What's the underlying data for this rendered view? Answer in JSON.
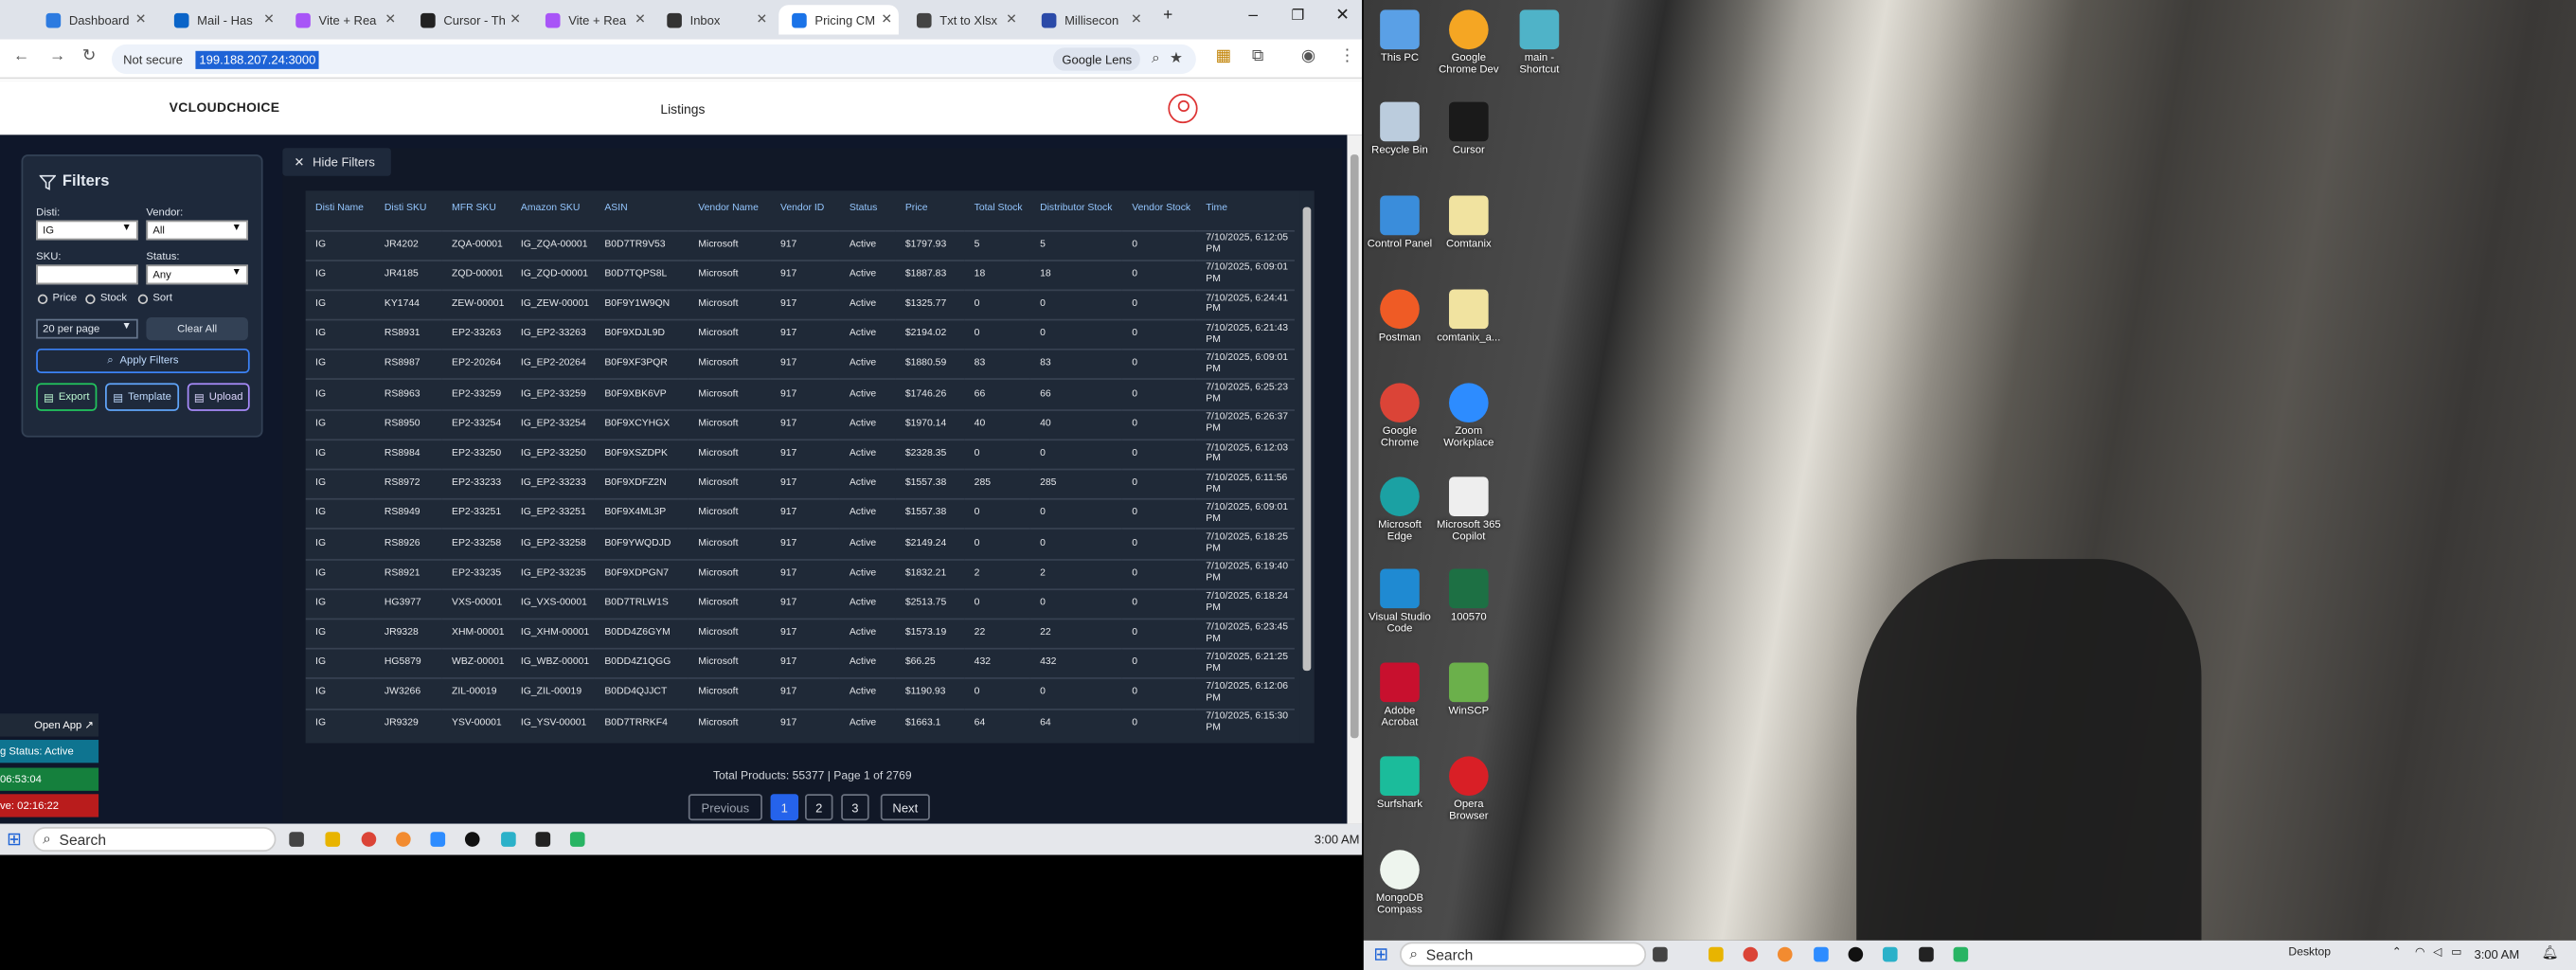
{
  "browser": {
    "tabs": [
      "Dashboard",
      "Mail - Has",
      "Vite + Rea",
      "Cursor - Th",
      "Vite + Rea",
      "Inbox",
      "Pricing CM",
      "Txt to Xlsx",
      "Millisecon"
    ],
    "address": {
      "security": "Not secure",
      "url": "199.188.207.24:3000"
    },
    "lens_label": "Google Lens"
  },
  "app": {
    "logo": "VCLOUDCHOICE",
    "nav_title": "Listings",
    "filters": {
      "title": "Filters",
      "disti_label": "Disti:",
      "disti_value": "IG",
      "vendor_label": "Vendor:",
      "vendor_value": "All",
      "sku_label": "SKU:",
      "sku_value": "",
      "status_label": "Status:",
      "status_value": "Any",
      "sort_options": [
        "Price",
        "Stock",
        "Sort"
      ],
      "per_page": "20 per page",
      "clear_all": "Clear All",
      "apply": "Apply Filters",
      "export": "Export",
      "template": "Template",
      "upload": "Upload"
    },
    "hide_filters": "Hide Filters",
    "table": {
      "headers": [
        "Disti Name",
        "Disti SKU",
        "MFR SKU",
        "Amazon SKU",
        "ASIN",
        "Vendor Name",
        "Vendor ID",
        "Status",
        "Price",
        "Total Stock",
        "Distributor Stock",
        "Vendor Stock",
        "Time"
      ],
      "rows": [
        [
          "IG",
          "JR4202",
          "ZQA-00001",
          "IG_ZQA-00001",
          "B0D7TR9V53",
          "Microsoft",
          "917",
          "Active",
          "$1797.93",
          "5",
          "5",
          "0",
          "7/10/2025, 6:12:05 PM"
        ],
        [
          "IG",
          "JR4185",
          "ZQD-00001",
          "IG_ZQD-00001",
          "B0D7TQPS8L",
          "Microsoft",
          "917",
          "Active",
          "$1887.83",
          "18",
          "18",
          "0",
          "7/10/2025, 6:09:01 PM"
        ],
        [
          "IG",
          "KY1744",
          "ZEW-00001",
          "IG_ZEW-00001",
          "B0F9Y1W9QN",
          "Microsoft",
          "917",
          "Active",
          "$1325.77",
          "0",
          "0",
          "0",
          "7/10/2025, 6:24:41 PM"
        ],
        [
          "IG",
          "RS8931",
          "EP2-33263",
          "IG_EP2-33263",
          "B0F9XDJL9D",
          "Microsoft",
          "917",
          "Active",
          "$2194.02",
          "0",
          "0",
          "0",
          "7/10/2025, 6:21:43 PM"
        ],
        [
          "IG",
          "RS8987",
          "EP2-20264",
          "IG_EP2-20264",
          "B0F9XF3PQR",
          "Microsoft",
          "917",
          "Active",
          "$1880.59",
          "83",
          "83",
          "0",
          "7/10/2025, 6:09:01 PM"
        ],
        [
          "IG",
          "RS8963",
          "EP2-33259",
          "IG_EP2-33259",
          "B0F9XBK6VP",
          "Microsoft",
          "917",
          "Active",
          "$1746.26",
          "66",
          "66",
          "0",
          "7/10/2025, 6:25:23 PM"
        ],
        [
          "IG",
          "RS8950",
          "EP2-33254",
          "IG_EP2-33254",
          "B0F9XCYHGX",
          "Microsoft",
          "917",
          "Active",
          "$1970.14",
          "40",
          "40",
          "0",
          "7/10/2025, 6:26:37 PM"
        ],
        [
          "IG",
          "RS8984",
          "EP2-33250",
          "IG_EP2-33250",
          "B0F9XSZDPK",
          "Microsoft",
          "917",
          "Active",
          "$2328.35",
          "0",
          "0",
          "0",
          "7/10/2025, 6:12:03 PM"
        ],
        [
          "IG",
          "RS8972",
          "EP2-33233",
          "IG_EP2-33233",
          "B0F9XDFZ2N",
          "Microsoft",
          "917",
          "Active",
          "$1557.38",
          "285",
          "285",
          "0",
          "7/10/2025, 6:11:56 PM"
        ],
        [
          "IG",
          "RS8949",
          "EP2-33251",
          "IG_EP2-33251",
          "B0F9X4ML3P",
          "Microsoft",
          "917",
          "Active",
          "$1557.38",
          "0",
          "0",
          "0",
          "7/10/2025, 6:09:01 PM"
        ],
        [
          "IG",
          "RS8926",
          "EP2-33258",
          "IG_EP2-33258",
          "B0F9YWQDJD",
          "Microsoft",
          "917",
          "Active",
          "$2149.24",
          "0",
          "0",
          "0",
          "7/10/2025, 6:18:25 PM"
        ],
        [
          "IG",
          "RS8921",
          "EP2-33235",
          "IG_EP2-33235",
          "B0F9XDPGN7",
          "Microsoft",
          "917",
          "Active",
          "$1832.21",
          "2",
          "2",
          "0",
          "7/10/2025, 6:19:40 PM"
        ],
        [
          "IG",
          "HG3977",
          "VXS-00001",
          "IG_VXS-00001",
          "B0D7TRLW1S",
          "Microsoft",
          "917",
          "Active",
          "$2513.75",
          "0",
          "0",
          "0",
          "7/10/2025, 6:18:24 PM"
        ],
        [
          "IG",
          "JR9328",
          "XHM-00001",
          "IG_XHM-00001",
          "B0DD4Z6GYM",
          "Microsoft",
          "917",
          "Active",
          "$1573.19",
          "22",
          "22",
          "0",
          "7/10/2025, 6:23:45 PM"
        ],
        [
          "IG",
          "HG5879",
          "WBZ-00001",
          "IG_WBZ-00001",
          "B0DD4Z1QGG",
          "Microsoft",
          "917",
          "Active",
          "$66.25",
          "432",
          "432",
          "0",
          "7/10/2025, 6:21:25 PM"
        ],
        [
          "IG",
          "JW3266",
          "ZIL-00019",
          "IG_ZIL-00019",
          "B0DD4QJJCT",
          "Microsoft",
          "917",
          "Active",
          "$1190.93",
          "0",
          "0",
          "0",
          "7/10/2025, 6:12:06 PM"
        ],
        [
          "IG",
          "JR9329",
          "YSV-00001",
          "IG_YSV-00001",
          "B0D7TRRKF4",
          "Microsoft",
          "917",
          "Active",
          "$1663.1",
          "64",
          "64",
          "0",
          "7/10/2025, 6:15:30 PM"
        ]
      ]
    },
    "pagination": {
      "info": "Total Products: 55377 | Page 1 of 2769",
      "previous": "Previous",
      "pages": [
        "1",
        "2",
        "3"
      ],
      "next": "Next"
    }
  },
  "status_widget": {
    "open_app": "Open App ↗",
    "status": "g Status: Active",
    "timer1": "06:53:04",
    "timer2": "ve: 02:16:22"
  },
  "taskbar": {
    "search": "Search",
    "time": "3:00 AM",
    "desktop_label": "Desktop"
  },
  "desktop_icons": [
    "This PC",
    "Google Chrome Dev",
    "main - Shortcut",
    "Recycle Bin",
    "Cursor",
    "Control Panel",
    "Comtanix",
    "Postman",
    "comtanix_a...",
    "Google Chrome",
    "Zoom Workplace",
    "Microsoft Edge",
    "Microsoft 365 Copilot",
    "Visual Studio Code",
    "100570",
    "Adobe Acrobat",
    "WinSCP",
    "Surfshark",
    "Opera Browser",
    "MongoDB Compass"
  ],
  "colors": {
    "app_bg": "#0f172a",
    "panel": "#1e293b",
    "accent": "#2563eb",
    "header_text": "#93c5fd",
    "brand_red": "#dd3333"
  }
}
